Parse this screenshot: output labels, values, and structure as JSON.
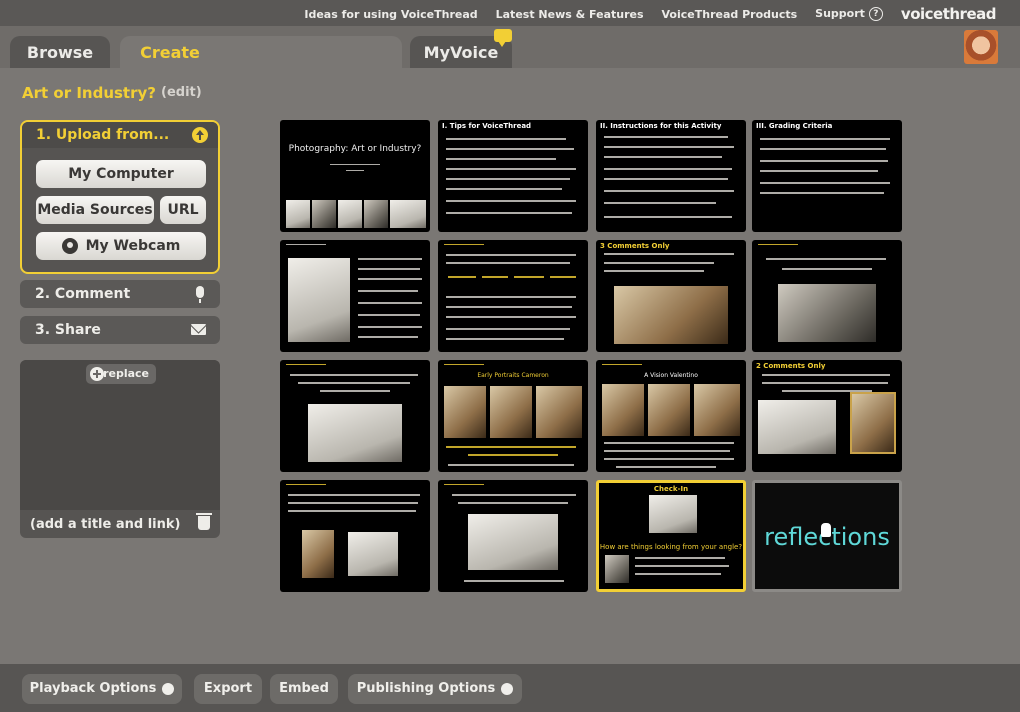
{
  "topbar": {
    "links": [
      "Ideas for using VoiceThread",
      "Latest News & Features",
      "VoiceThread Products",
      "Support"
    ],
    "logo": "voicethread"
  },
  "tabs": {
    "browse": "Browse",
    "create": "Create",
    "myvoice": "MyVoice"
  },
  "project": {
    "title": "Art or Industry?",
    "edit": "(edit)"
  },
  "upload": {
    "header": "1. Upload from...",
    "my_computer": "My Computer",
    "media_sources": "Media Sources",
    "url": "URL",
    "webcam": "My Webcam"
  },
  "steps": {
    "comment": "2. Comment",
    "share": "3. Share"
  },
  "media": {
    "replace": "replace",
    "add_title": "(add a title and link)"
  },
  "slides": {
    "s1_title": "Photography: Art or Industry?",
    "s2_title": "I. Tips for VoiceThread",
    "s3_title": "II. Instructions for this Activity",
    "s4_title": "III. Grading Criteria",
    "s7_title": "3 Comments Only",
    "s10_title": "Early Portraits Cameron",
    "s11_title": "A Vision Valentino",
    "s12_title": "2 Comments Only",
    "s15_title": "Check-In",
    "s15_caption": "How are things looking from your angle?",
    "s16_text": "reflections"
  },
  "bottom": {
    "playback": "Playback Options",
    "export": "Export",
    "embed": "Embed",
    "publishing": "Publishing Options"
  },
  "colors": {
    "accent": "#f2cf35",
    "background": "#7a7774",
    "reflections": "#5fd8d8"
  }
}
